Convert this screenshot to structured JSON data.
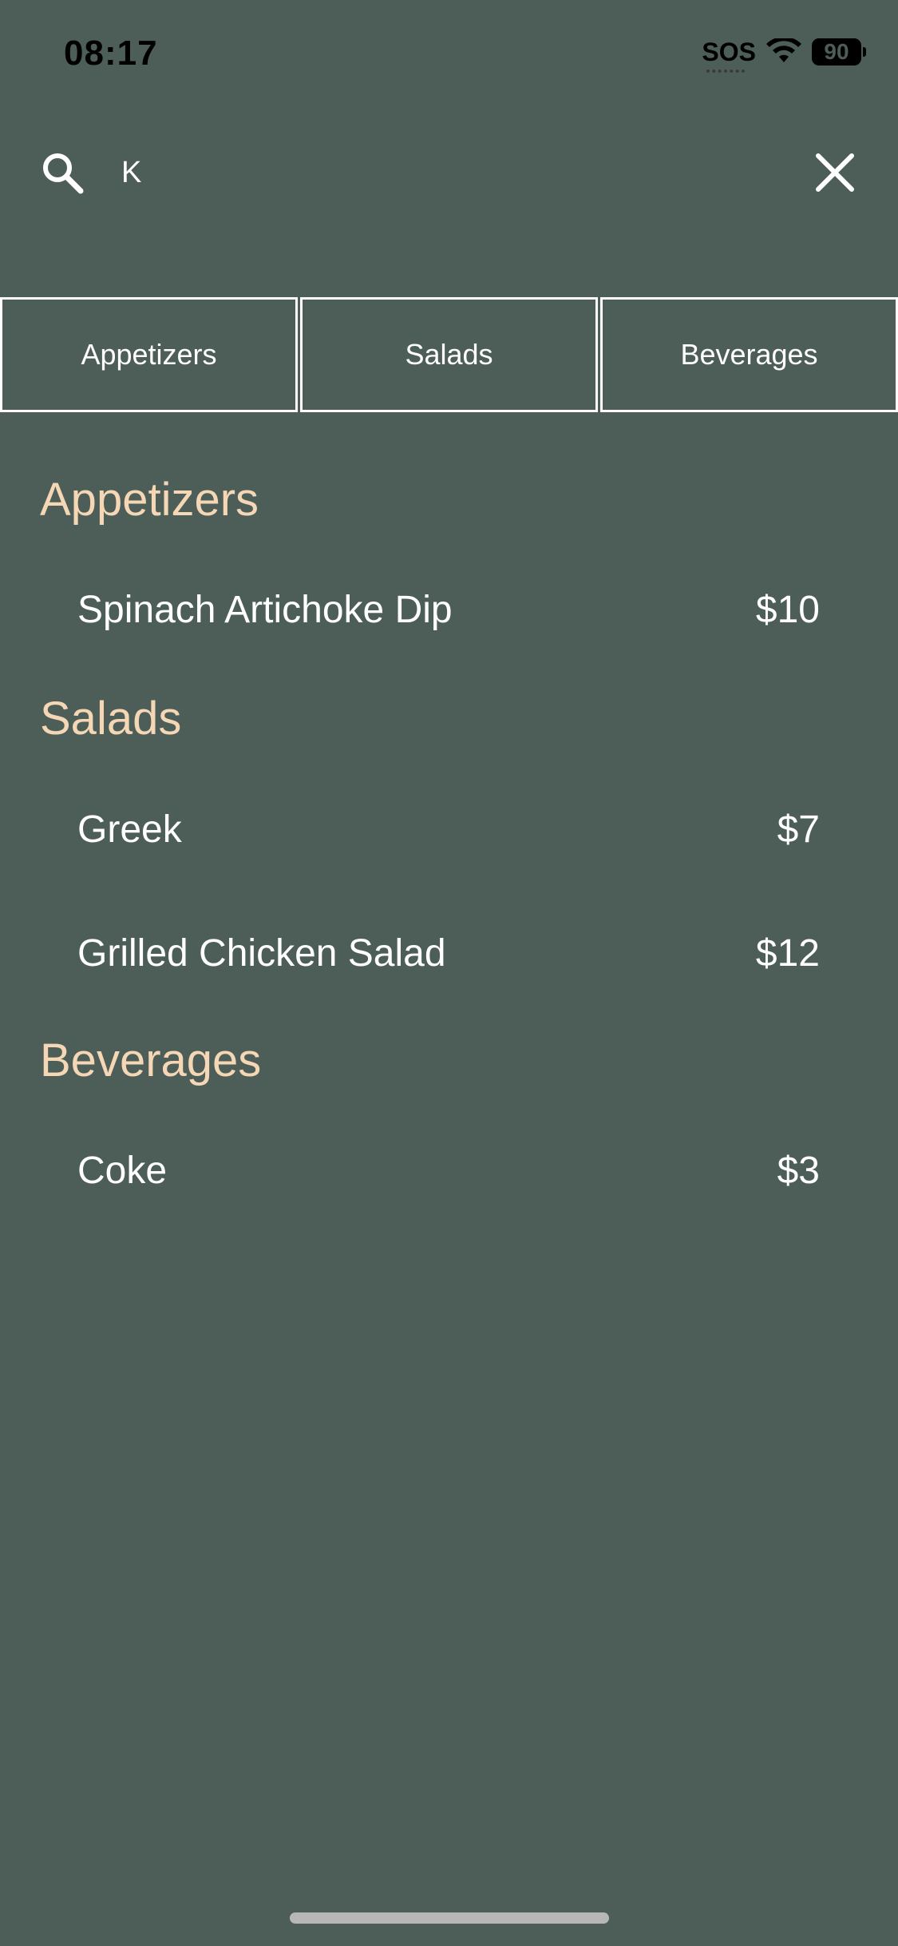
{
  "status_bar": {
    "time": "08:17",
    "sos": "SOS",
    "battery": "90"
  },
  "search": {
    "value": "K",
    "placeholder": ""
  },
  "tabs": [
    {
      "label": "Appetizers"
    },
    {
      "label": "Salads"
    },
    {
      "label": "Beverages"
    }
  ],
  "sections": [
    {
      "title": "Appetizers",
      "items": [
        {
          "name": "Spinach Artichoke Dip",
          "price": "$10"
        }
      ]
    },
    {
      "title": "Salads",
      "items": [
        {
          "name": "Greek",
          "price": "$7"
        },
        {
          "name": "Grilled Chicken Salad",
          "price": "$12"
        }
      ]
    },
    {
      "title": "Beverages",
      "items": [
        {
          "name": "Coke",
          "price": "$3"
        }
      ]
    }
  ],
  "colors": {
    "background": "#4d5e58",
    "section_title": "#f5d7b5",
    "text": "#ffffff"
  }
}
